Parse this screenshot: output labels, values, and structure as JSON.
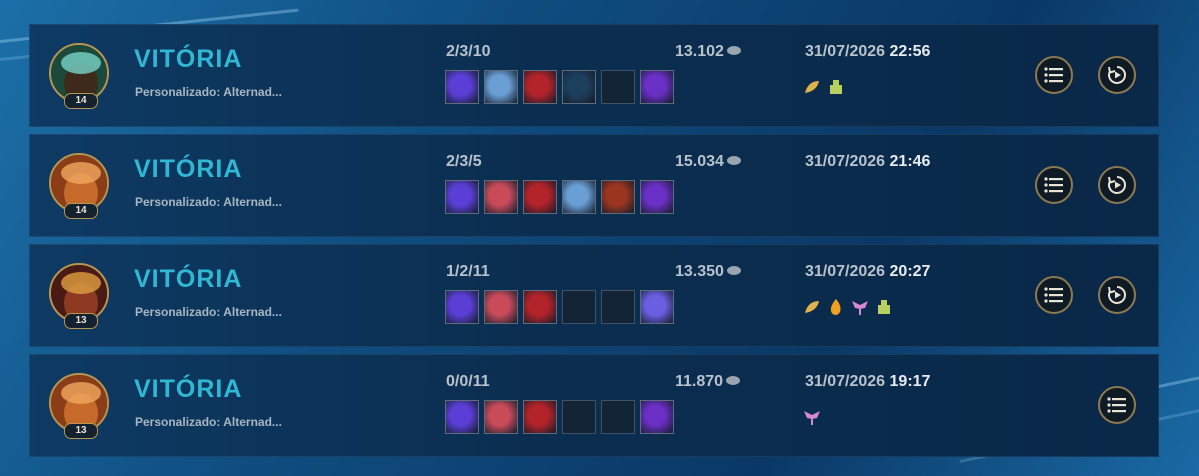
{
  "matches": [
    {
      "result": "VITÓRIA",
      "mode": "Personalizado: Alternad...",
      "level": "14",
      "kda": "2/3/10",
      "gold": "13.102",
      "date": "31/07/2026",
      "time": "22:56",
      "portrait_colors": [
        "#1b4a3c",
        "#3d2a1a",
        "#7bd3c8"
      ],
      "items": [
        "#5a3fd6",
        "#6a9fd6",
        "#b3232a",
        "#1d3f5e",
        "",
        "#6a2fc4"
      ],
      "badges": [
        "leaf-badge-icon",
        "totem-badge-icon"
      ],
      "has_replay": true
    },
    {
      "result": "VITÓRIA",
      "mode": "Personalizado: Alternad...",
      "level": "14",
      "kda": "2/3/5",
      "gold": "15.034",
      "date": "31/07/2026",
      "time": "21:46",
      "portrait_colors": [
        "#8a3d17",
        "#c56a2a",
        "#f0a860"
      ],
      "items": [
        "#5a3fd6",
        "#c94b5a",
        "#b3232a",
        "#6a9fd6",
        "#9c3520",
        "#6a2fc4"
      ],
      "badges": [],
      "has_replay": true
    },
    {
      "result": "VITÓRIA",
      "mode": "Personalizado: Alternad...",
      "level": "13",
      "kda": "1/2/11",
      "gold": "13.350",
      "date": "31/07/2026",
      "time": "20:27",
      "portrait_colors": [
        "#4a1a14",
        "#8e3a22",
        "#e0a040"
      ],
      "items": [
        "#5a3fd6",
        "#c94b5a",
        "#b3232a",
        "",
        "",
        "#6a5fe0"
      ],
      "badges": [
        "leaf-badge-icon",
        "flame-badge-icon",
        "wings-badge-icon",
        "totem-badge-icon"
      ],
      "has_replay": true
    },
    {
      "result": "VITÓRIA",
      "mode": "Personalizado: Alternad...",
      "level": "13",
      "kda": "0/0/11",
      "gold": "11.870",
      "date": "31/07/2026",
      "time": "19:17",
      "portrait_colors": [
        "#8a3d17",
        "#c56a2a",
        "#f0a860"
      ],
      "items": [
        "#5a3fd6",
        "#c94b5a",
        "#b3232a",
        "",
        "",
        "#6a2fc4"
      ],
      "badges": [
        "wings-badge-icon"
      ],
      "has_replay": false
    }
  ],
  "colors": {
    "result": "#2fb7d3",
    "accent_border": "#b9954f"
  },
  "icons": {
    "details": "list-icon",
    "replay": "replay-icon",
    "gold": "gold-coin-icon"
  }
}
